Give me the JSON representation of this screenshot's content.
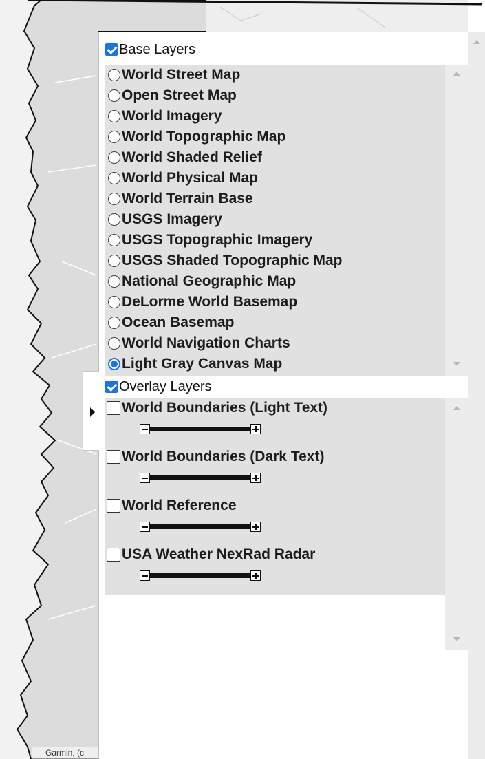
{
  "attribution": "Garmin, (c",
  "base_layers": {
    "header": "Base Layers",
    "checked": true,
    "selected": "Light Gray Canvas Map",
    "items": [
      "World Street Map",
      "Open Street Map",
      "World Imagery",
      "World Topographic Map",
      "World Shaded Relief",
      "World Physical Map",
      "World Terrain Base",
      "USGS Imagery",
      "USGS Topographic Imagery",
      "USGS Shaded Topographic Map",
      "National Geographic Map",
      "DeLorme World Basemap",
      "Ocean Basemap",
      "World Navigation Charts",
      "Light Gray Canvas Map"
    ]
  },
  "overlay_layers": {
    "header": "Overlay Layers",
    "checked": true,
    "items": [
      {
        "label": "World Boundaries (Light Text)",
        "checked": false,
        "opacity": 1.0
      },
      {
        "label": "World Boundaries (Dark Text)",
        "checked": false,
        "opacity": 1.0
      },
      {
        "label": "World Reference",
        "checked": false,
        "opacity": 1.0
      },
      {
        "label": "USA Weather NexRad Radar",
        "checked": false,
        "opacity": 1.0
      }
    ]
  },
  "icons": {
    "collapse": "chevron-right-icon",
    "scroll_up": "arrow-up-icon",
    "scroll_down": "arrow-down-icon",
    "opacity_decrease": "minus-icon",
    "opacity_increase": "plus-icon"
  },
  "colors": {
    "accent": "#1a73e8",
    "list_background": "#e1e1e1",
    "map_land": "#dcdcdc",
    "map_water": "#f5f5f5"
  }
}
